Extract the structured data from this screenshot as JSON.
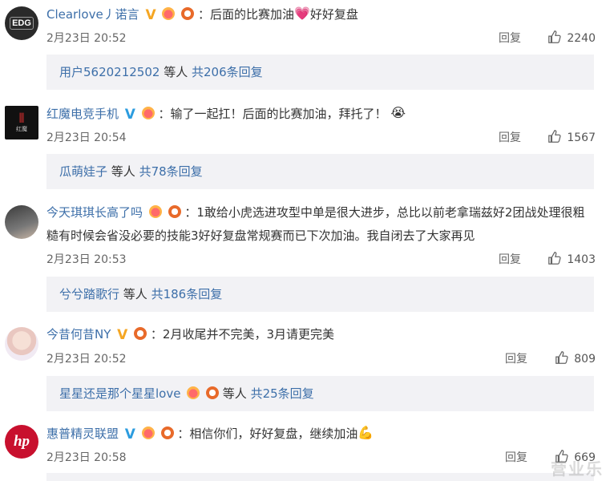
{
  "comments": [
    {
      "username": "Clearlove丿诺言",
      "text": "：后面的比赛加油",
      "text_after_emoji": "好好复盘",
      "emoji": "💗",
      "time": "2月23日 20:52",
      "reply_label": "回复",
      "likes": "2240",
      "replies": {
        "users": "用户5620212502",
        "middle": " 等人 ",
        "count": "共206条回复"
      }
    },
    {
      "username": "红魔电竞手机",
      "text": "：输了一起扛！后面的比赛加油，拜托了！",
      "emoji": "😭",
      "time": "2月23日 20:54",
      "reply_label": "回复",
      "likes": "1567",
      "replies": {
        "users": "瓜萌娃子",
        "middle": " 等人 ",
        "count": "共78条回复"
      }
    },
    {
      "username": "今天琪琪长高了吗",
      "text": "：1敢给小虎选进攻型中单是很大进步，总比以前老拿瑞兹好2团战处理很粗糙有时候会省没必要的技能3好好复盘常规赛而已下次加油。我自闭去了大家再见",
      "time": "2月23日 20:53",
      "reply_label": "回复",
      "likes": "1403",
      "replies": {
        "users": "兮兮踏歌行",
        "middle": " 等人 ",
        "count": "共186条回复"
      }
    },
    {
      "username": "今昔何昔NY",
      "text": "：2月收尾并不完美，3月请更完美",
      "time": "2月23日 20:52",
      "reply_label": "回复",
      "likes": "809",
      "replies": {
        "users": "星星还是那个星星love",
        "middle": " 等人 ",
        "count": "共25条回复"
      }
    },
    {
      "username": "惠普精灵联盟",
      "text": "：相信你们，好好复盘，继续加油",
      "emoji": "💪",
      "time": "2月23日 20:58",
      "reply_label": "回复",
      "likes": "669"
    }
  ],
  "avatars": {
    "edg": "EDG",
    "redmagic": "红魔",
    "hp": "hp"
  },
  "watermark": "营业乐"
}
